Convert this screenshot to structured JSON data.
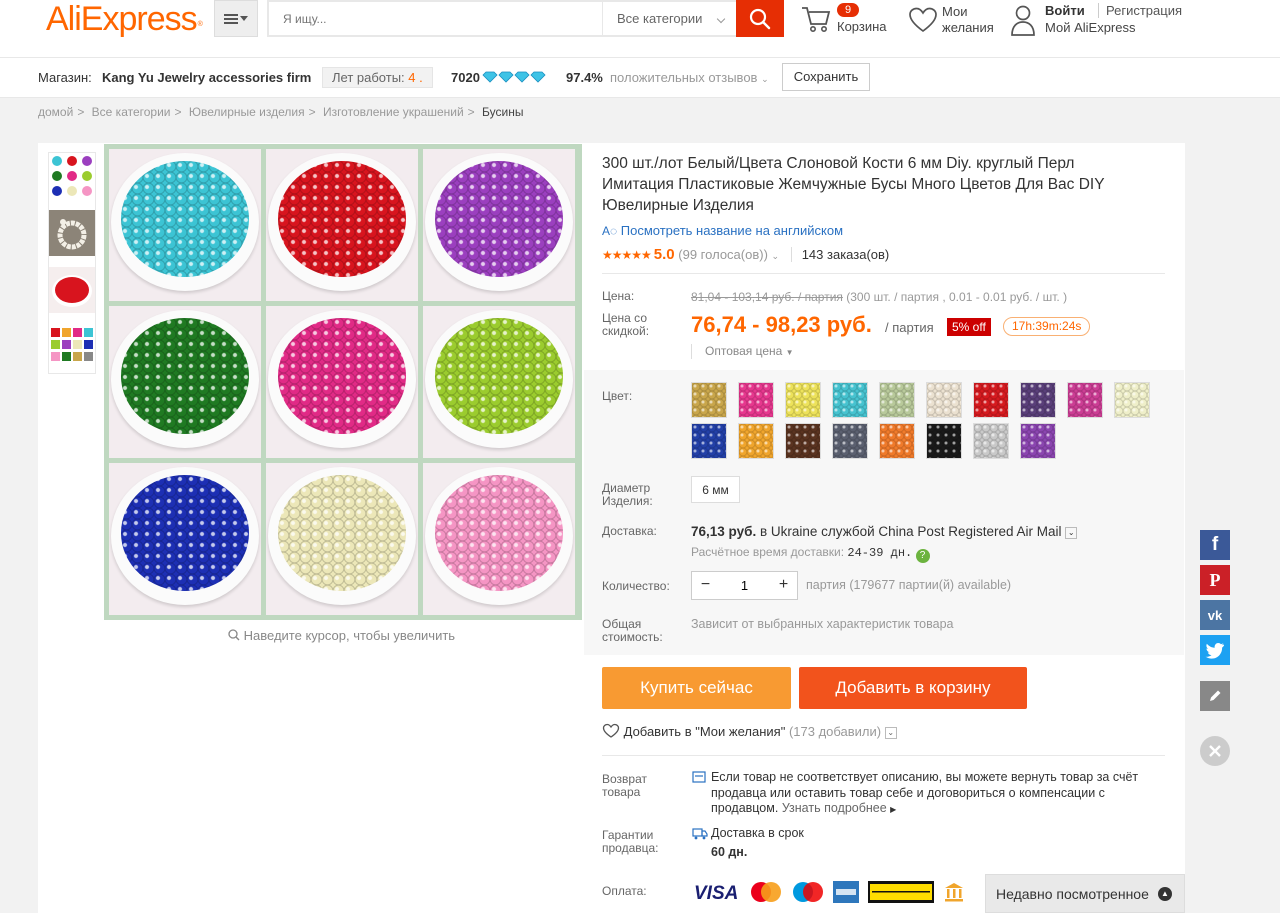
{
  "header": {
    "logo": "AliExpress",
    "search_placeholder": "Я ищу...",
    "search_category": "Все категории",
    "cart_count": "9",
    "cart_label": "Корзина",
    "wishlist_label": "Мои желания",
    "login": "Войти",
    "register": "Регистрация",
    "my_account": "Мой AliExpress"
  },
  "store": {
    "label": "Магазин:",
    "name": "Kang Yu Jewelry accessories firm",
    "years_label": "Лет работы:",
    "years_value": "4 .",
    "score": "7020",
    "feedback_pct": "97.4%",
    "feedback_label": "положительных отзывов",
    "save_button": "Сохранить"
  },
  "breadcrumb": [
    "домой",
    "Все категории",
    "Ювелирные изделия",
    "Изготовление украшений",
    "Бусины"
  ],
  "gallery": {
    "zoom_hint": "Наведите курсор, чтобы увеличить",
    "bead_colors": [
      "#3cc4d4",
      "#d8141e",
      "#9b3fbf",
      "#1f7a22",
      "#e12a86",
      "#9bcc2e",
      "#1d2fb4",
      "#ece7b8",
      "#f595c4"
    ]
  },
  "product": {
    "title": "300 шт./лот Белый/Цвета Слоновой Кости 6 мм Diy. круглый Перл Имитация Пластиковые Жемчужные Бусы Много Цветов Для Вас DIY Ювелирные Изделия",
    "translate_link": "Посмотреть название на английском",
    "rating": "5.0",
    "votes": "(99 голоса(ов))",
    "orders": "143 заказа(ов)",
    "price_label": "Цена:",
    "price_old": "81,04 - 103,14 руб. / партия",
    "price_old_note": "(300 шт. / партия , 0.01 - 0.01 руб. / шт. )",
    "discount_label": "Цена со скидкой:",
    "price_new": "76,74 - 98,23 руб.",
    "price_unit": "/ партия",
    "discount_badge": "5% off",
    "timer": "17h:39m:24s",
    "wholesale": "Оптовая цена",
    "color_label": "Цвет:",
    "swatch_colors": [
      "#c9a64b",
      "#e7378e",
      "#ede25a",
      "#46c3d0",
      "#b8c99a",
      "#ebe1d0",
      "#d61a1f",
      "#5a3f7a",
      "#cc3d94",
      "#efefc9",
      "#2340a8",
      "#f0a52c",
      "#5a3320",
      "#5b6070",
      "#f07a2a",
      "#1a1a1a",
      "#c9c9c9",
      "#8b45b0"
    ],
    "size_label": "Диаметр Изделия:",
    "size_value": "6 мм",
    "shipping_label": "Доставка:",
    "shipping_price": "76,13 руб.",
    "shipping_to": "в Ukraine службой China Post Registered Air Mail",
    "shipping_time_label": "Расчётное время доставки:",
    "shipping_time": "24-39 дн.",
    "qty_label": "Количество:",
    "qty_value": "1",
    "qty_note": "партия (179677 партии(й) available)",
    "total_label": "Общая стоимость:",
    "total_note": "Зависит от выбранных характеристик товара",
    "buy_now": "Купить сейчас",
    "add_to_cart": "Добавить в корзину",
    "add_wish": "Добавить в \"Мои желания\"",
    "wish_count": "(173 добавили)",
    "return_label": "Возврат товара",
    "return_text": "Если товар не соответствует описанию, вы можете вернуть товар за счёт продавца или оставить товар себе и договориться о компенсации с продавцом.",
    "return_more": "Узнать подробнее",
    "guarantee_label": "Гарантии продавца:",
    "guarantee_text": "Доставка в срок",
    "guarantee_days": "60 дн.",
    "payment_label": "Оплата:"
  },
  "recently_viewed": "Недавно посмотренное",
  "social": {
    "facebook_color": "#3b5998",
    "pinterest_color": "#cb2027",
    "vk_color": "#4c75a3",
    "twitter_color": "#1da1f2"
  }
}
